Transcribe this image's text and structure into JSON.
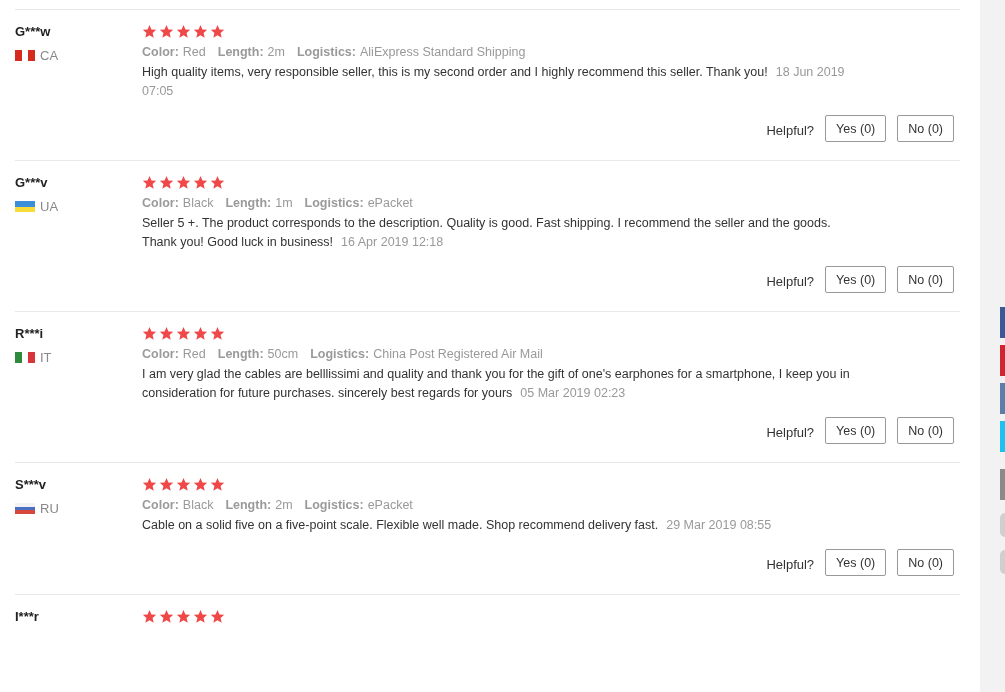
{
  "reviews": [
    {
      "user": "G***w",
      "country": "CA",
      "stars": 5,
      "attributes": [
        {
          "label": "Color:",
          "value": "Red"
        },
        {
          "label": "Length:",
          "value": "2m"
        },
        {
          "label": "Logistics:",
          "value": "AliExpress Standard Shipping"
        }
      ],
      "comment": "High quality items, very responsible seller, this is my second order and I highly recommend this seller. Thank you!",
      "date": "18 Jun 2019 07:05",
      "helpful_label": "Helpful?",
      "yes_button": "Yes (0)",
      "no_button": "No (0)"
    },
    {
      "user": "G***v",
      "country": "UA",
      "stars": 5,
      "attributes": [
        {
          "label": "Color:",
          "value": "Black"
        },
        {
          "label": "Length:",
          "value": "1m"
        },
        {
          "label": "Logistics:",
          "value": "ePacket"
        }
      ],
      "comment": "Seller 5 +. The product corresponds to the description. Quality is good. Fast shipping. I recommend the seller and the goods. Thank you! Good luck in business!",
      "date": "16 Apr 2019 12:18",
      "helpful_label": "Helpful?",
      "yes_button": "Yes (0)",
      "no_button": "No (0)"
    },
    {
      "user": "R***i",
      "country": "IT",
      "stars": 5,
      "attributes": [
        {
          "label": "Color:",
          "value": "Red"
        },
        {
          "label": "Length:",
          "value": "50cm"
        },
        {
          "label": "Logistics:",
          "value": "China Post Registered Air Mail"
        }
      ],
      "comment": "I am very glad the cables are belllissimi and quality and thank you for the gift of one's earphones for a smartphone, I keep you in consideration for future purchases. sincerely best regards for yours",
      "date": "05 Mar 2019 02:23",
      "helpful_label": "Helpful?",
      "yes_button": "Yes (0)",
      "no_button": "No (0)"
    },
    {
      "user": "S***v",
      "country": "RU",
      "stars": 5,
      "attributes": [
        {
          "label": "Color:",
          "value": "Black"
        },
        {
          "label": "Length:",
          "value": "2m"
        },
        {
          "label": "Logistics:",
          "value": "ePacket"
        }
      ],
      "comment": "Cable on a solid five on a five-point scale. Flexible well made. Shop recommend delivery fast.",
      "date": "29 Mar 2019 08:55",
      "helpful_label": "Helpful?",
      "yes_button": "Yes (0)",
      "no_button": "No (0)"
    },
    {
      "user": "I***r",
      "stars": 5
    }
  ]
}
